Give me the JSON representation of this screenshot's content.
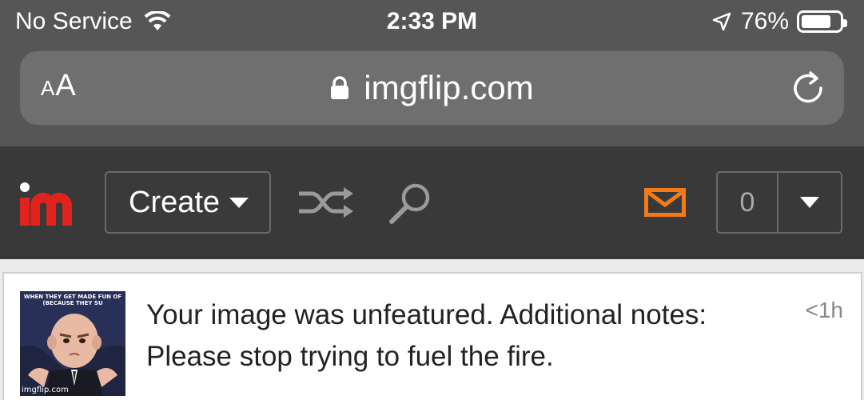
{
  "status_bar": {
    "carrier": "No Service",
    "time": "2:33 PM",
    "battery": "76%",
    "battery_level": 0.76
  },
  "browser": {
    "text_size_label_small": "A",
    "text_size_label_large": "A",
    "url": "imgflip.com"
  },
  "nav": {
    "logo_alt": "im",
    "create_label": "Create",
    "notification_count": "0",
    "accent_color": "#f47a17",
    "logo_color": "#e0231c"
  },
  "notification": {
    "message": "Your image was unfeatured. Additional notes: Please stop trying to fuel the fire.",
    "time": "<1h",
    "thumb_caption": "WHEN THEY GET MADE FUN OF (BECAUSE THEY SU",
    "thumb_watermark": "imgflip.com"
  }
}
